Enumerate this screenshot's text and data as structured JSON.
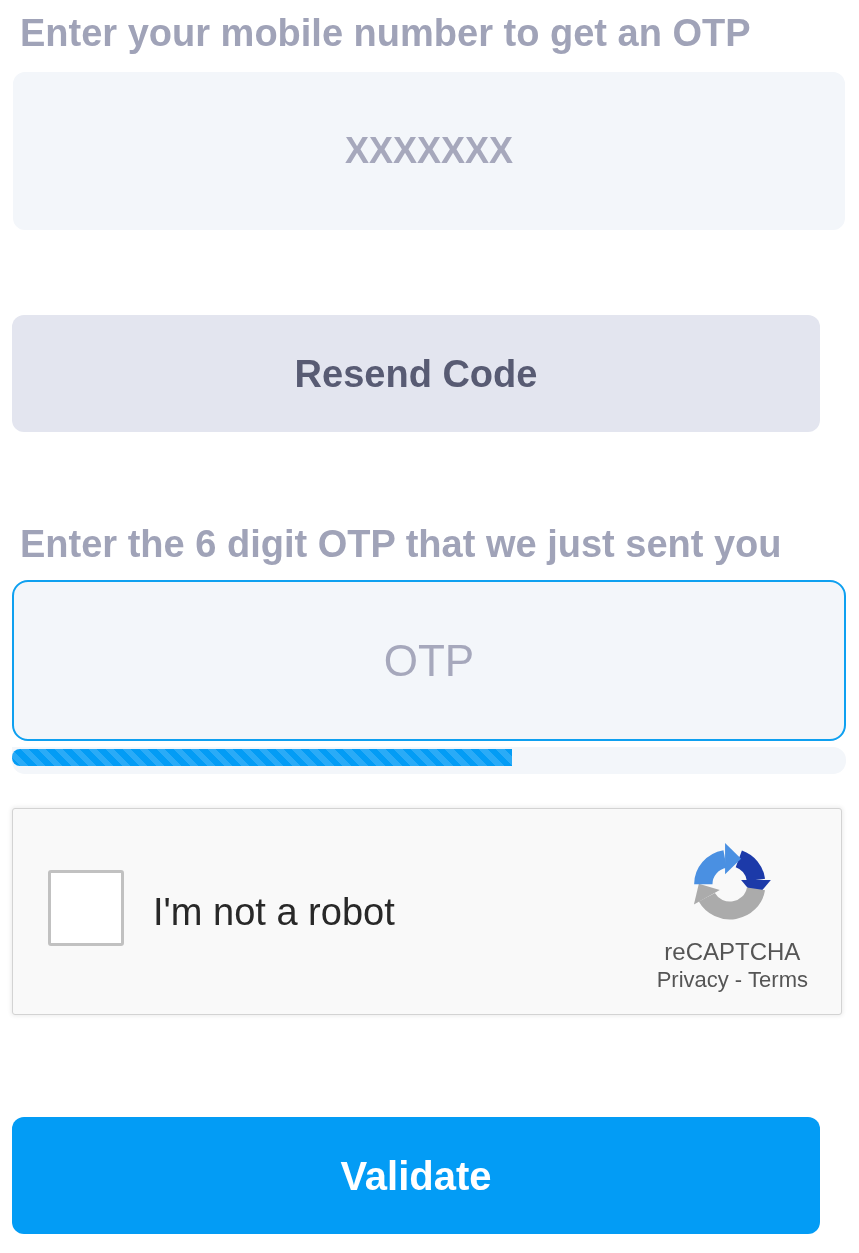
{
  "phone": {
    "label": "Enter your mobile number to get an OTP",
    "placeholder": "XXXXXXX"
  },
  "resend_button": {
    "label": "Resend Code"
  },
  "otp": {
    "label": "Enter the 6 digit OTP that we just sent you",
    "placeholder": "OTP",
    "focused": true
  },
  "timer": {
    "level": 0.6
  },
  "captcha": {
    "label": "I'm not a robot",
    "checked": false,
    "brand": "reCAPTCHA",
    "links": [
      {
        "label": "Privacy"
      },
      {
        "label": "Terms"
      }
    ],
    "separator": "-"
  },
  "validate_button": {
    "label": "Validate"
  }
}
